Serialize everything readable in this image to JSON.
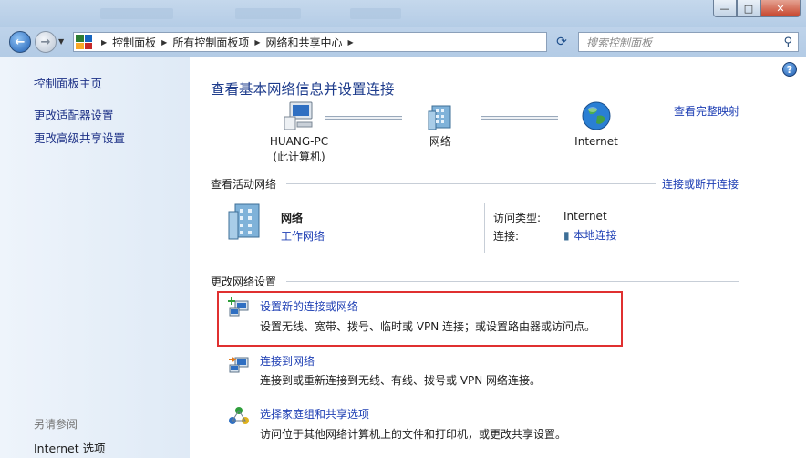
{
  "address": {
    "crumbs": [
      "控制面板",
      "所有控制面板项",
      "网络和共享中心"
    ],
    "search_placeholder": "搜索控制面板"
  },
  "window_buttons": {
    "minimize": "—",
    "maximize": "□",
    "close": "✕"
  },
  "sidebar": {
    "items": [
      "控制面板主页",
      "更改适配器设置",
      "更改高级共享设置"
    ],
    "see_also_heading": "另请参阅",
    "see_also_items": [
      "Internet 选项"
    ]
  },
  "main": {
    "title": "查看基本网络信息并设置连接",
    "full_map_link": "查看完整映射",
    "map": {
      "computer_name": "HUANG-PC",
      "computer_sub": "(此计算机)",
      "network_label": "网络",
      "internet_label": "Internet"
    },
    "active": {
      "heading": "查看活动网络",
      "connect_link": "连接或断开连接",
      "network_name": "网络",
      "network_type": "工作网络",
      "access_type_key": "访问类型:",
      "access_type_value": "Internet",
      "connection_key": "连接:",
      "connection_value": "本地连接"
    },
    "change": {
      "heading": "更改网络设置",
      "tasks": [
        {
          "title": "设置新的连接或网络",
          "desc": "设置无线、宽带、拨号、临时或 VPN 连接；或设置路由器或访问点。"
        },
        {
          "title": "连接到网络",
          "desc": "连接到或重新连接到无线、有线、拨号或 VPN 网络连接。"
        },
        {
          "title": "选择家庭组和共享选项",
          "desc": "访问位于其他网络计算机上的文件和打印机，或更改共享设置。"
        }
      ]
    }
  }
}
